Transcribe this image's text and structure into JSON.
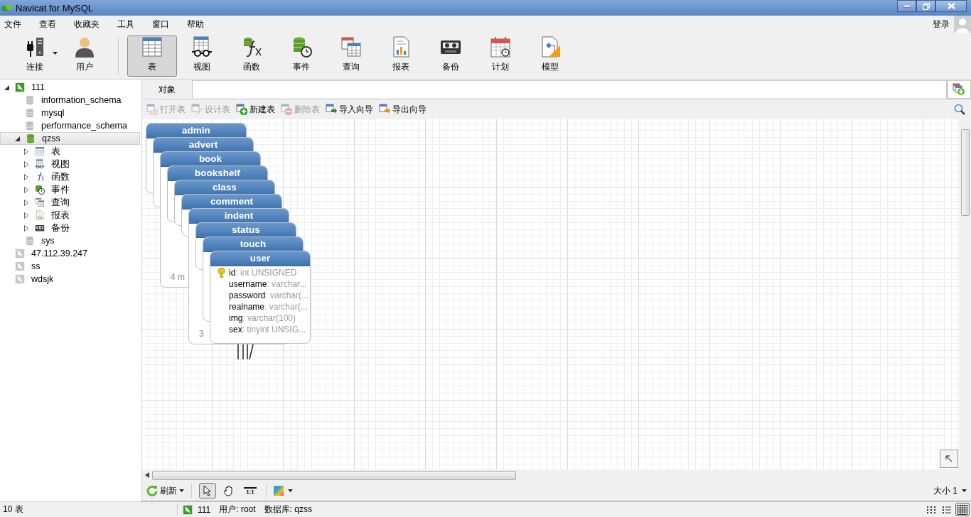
{
  "window": {
    "title": "Navicat for MySQL"
  },
  "menu": [
    "文件",
    "查看",
    "收藏夹",
    "工具",
    "窗口",
    "帮助"
  ],
  "account": {
    "label": "登录"
  },
  "toolbar": {
    "connect_items": [
      {
        "kind": "connection",
        "label": "连接",
        "dropdown": true,
        "selected": false
      },
      {
        "kind": "user",
        "label": "用户",
        "dropdown": false,
        "selected": false
      }
    ],
    "object_items": [
      {
        "kind": "table",
        "label": "表",
        "selected": true
      },
      {
        "kind": "view",
        "label": "视图",
        "selected": false
      },
      {
        "kind": "function",
        "label": "函数",
        "selected": false
      },
      {
        "kind": "event",
        "label": "事件",
        "selected": false
      },
      {
        "kind": "query",
        "label": "查询",
        "selected": false
      },
      {
        "kind": "report",
        "label": "报表",
        "selected": false
      },
      {
        "kind": "backup",
        "label": "备份",
        "selected": false
      },
      {
        "kind": "schedule",
        "label": "计划",
        "selected": false
      },
      {
        "kind": "model",
        "label": "模型",
        "selected": false
      }
    ]
  },
  "sidebar": {
    "tree": [
      {
        "kind": "connection",
        "label": "111",
        "active": true,
        "expanded": true,
        "selected": false,
        "children": [
          {
            "kind": "database",
            "label": "information_schema",
            "active": false,
            "selected": false
          },
          {
            "kind": "database",
            "label": "mysql",
            "active": false,
            "selected": false
          },
          {
            "kind": "database",
            "label": "performance_schema",
            "active": false,
            "selected": false
          },
          {
            "kind": "database",
            "label": "qzss",
            "active": true,
            "expanded": true,
            "selected": true,
            "children": [
              {
                "kind": "table",
                "label": "表",
                "expanded": false,
                "selected": false
              },
              {
                "kind": "view",
                "label": "视图",
                "expanded": false,
                "selected": false
              },
              {
                "kind": "function",
                "label": "函数",
                "expanded": false,
                "selected": false
              },
              {
                "kind": "event",
                "label": "事件",
                "expanded": false,
                "selected": false
              },
              {
                "kind": "query",
                "label": "查询",
                "expanded": false,
                "selected": false
              },
              {
                "kind": "report",
                "label": "报表",
                "expanded": false,
                "selected": false
              },
              {
                "kind": "backup",
                "label": "备份",
                "expanded": false,
                "selected": false
              }
            ]
          },
          {
            "kind": "database",
            "label": "sys",
            "active": false,
            "selected": false
          }
        ]
      },
      {
        "kind": "connection",
        "label": "47.112.39.247",
        "active": false,
        "selected": false
      },
      {
        "kind": "connection",
        "label": "ss",
        "active": false,
        "selected": false
      },
      {
        "kind": "connection",
        "label": "wdsjk",
        "active": false,
        "selected": false
      }
    ]
  },
  "tabs": [
    {
      "label": "对象",
      "selected": true
    }
  ],
  "actions": [
    {
      "kind": "open",
      "label": "打开表",
      "disabled": true
    },
    {
      "kind": "design",
      "label": "设计表",
      "disabled": true
    },
    {
      "kind": "new",
      "label": "新建表",
      "disabled": false
    },
    {
      "kind": "delete",
      "label": "删除表",
      "disabled": true
    },
    {
      "kind": "import",
      "label": "导入向导",
      "disabled": false
    },
    {
      "kind": "export",
      "label": "导出向导",
      "disabled": false
    }
  ],
  "canvas": {
    "cards": [
      {
        "name": "admin"
      },
      {
        "name": "advert"
      },
      {
        "name": "book",
        "footer": "4 m"
      },
      {
        "name": "bookshelf"
      },
      {
        "name": "class"
      },
      {
        "name": "comment"
      },
      {
        "name": "indent",
        "footer": "3"
      },
      {
        "name": "status"
      },
      {
        "name": "touch"
      },
      {
        "name": "user",
        "fields": [
          {
            "name": "id",
            "type": ": int UNSIGNED",
            "key": true
          },
          {
            "name": "username",
            "type": ": varchar...",
            "key": false
          },
          {
            "name": "password",
            "type": ": varchar(...",
            "key": false
          },
          {
            "name": "realname",
            "type": ": varchar(...",
            "key": false
          },
          {
            "name": "img",
            "type": ": varchar(100)",
            "key": false
          },
          {
            "name": "sex",
            "type": ": tinyint UNSIG...",
            "key": false
          }
        ]
      }
    ]
  },
  "bottom_toolbar": {
    "refresh": {
      "label": "刷新"
    },
    "tools": [
      {
        "kind": "pointer",
        "selected": true
      },
      {
        "kind": "hand",
        "selected": false
      },
      {
        "kind": "actual_size",
        "label": "1:1",
        "selected": false
      }
    ],
    "size": {
      "label": "大小 1"
    }
  },
  "status_bar": {
    "count": "10 表",
    "connection": "111",
    "user": "用户: root",
    "database": "数据库: qzss",
    "views": [
      {
        "kind": "grid",
        "selected": false
      },
      {
        "kind": "list",
        "selected": false
      },
      {
        "kind": "diagram",
        "selected": true
      }
    ]
  }
}
